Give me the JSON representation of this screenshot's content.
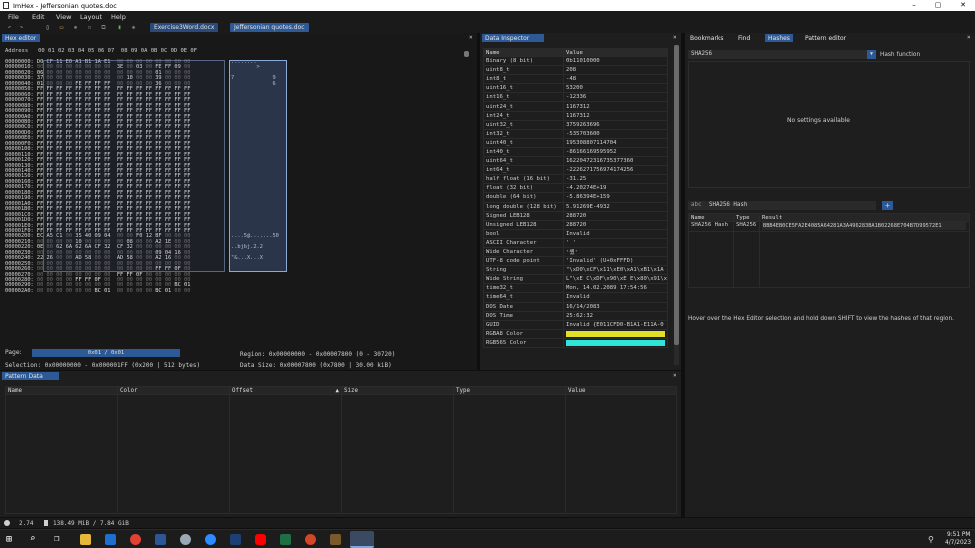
{
  "window": {
    "title": "ImHex - Jeffersonian quotes.doc",
    "min": "–",
    "max": "▢",
    "close": "✕"
  },
  "menu": [
    "File",
    "Edit",
    "View",
    "Layout",
    "Help"
  ],
  "file_tabs": [
    "Exercise3Word.docx",
    "Jeffersonian quotes.doc"
  ],
  "hex_editor": {
    "tab": "Hex editor",
    "close": "×",
    "header": "Address   00 01 02 03 04 05 06 07  08 09 0A 0B 0C 0D 0E 0F",
    "rows": [
      {
        "addr": "00000000:",
        "hex": "D0 CF 11 E0 A1 B1 1A E1  00 00 00 00 00 00 00 00",
        "ascii": "........"
      },
      {
        "addr": "00000010:",
        "hex": "00 00 00 00 00 00 00 00  3E 00 03 00 FE FF 09 00",
        "ascii": "        >"
      },
      {
        "addr": "00000020:",
        "hex": "06 00 00 00 00 00 00 00  00 00 00 00 01 00 00 00",
        "ascii": ""
      },
      {
        "addr": "00000030:",
        "hex": "37 00 00 00 00 00 00 00  00 10 00 00 39 00 00 00",
        "ascii": "7            9"
      },
      {
        "addr": "00000040:",
        "hex": "01 00 00 00 FE FF FF FF  00 00 00 00 36 00 00 00",
        "ascii": "             6"
      },
      {
        "addr": "00000050:",
        "hex": "FF FF FF FF FF FF FF FF  FF FF FF FF FF FF FF FF",
        "ascii": ""
      },
      {
        "addr": "00000060:",
        "hex": "FF FF FF FF FF FF FF FF  FF FF FF FF FF FF FF FF",
        "ascii": ""
      },
      {
        "addr": "00000070:",
        "hex": "FF FF FF FF FF FF FF FF  FF FF FF FF FF FF FF FF",
        "ascii": ""
      },
      {
        "addr": "00000080:",
        "hex": "FF FF FF FF FF FF FF FF  FF FF FF FF FF FF FF FF",
        "ascii": ""
      },
      {
        "addr": "00000090:",
        "hex": "FF FF FF FF FF FF FF FF  FF FF FF FF FF FF FF FF",
        "ascii": ""
      },
      {
        "addr": "000000A0:",
        "hex": "FF FF FF FF FF FF FF FF  FF FF FF FF FF FF FF FF",
        "ascii": ""
      },
      {
        "addr": "000000B0:",
        "hex": "FF FF FF FF FF FF FF FF  FF FF FF FF FF FF FF FF",
        "ascii": ""
      },
      {
        "addr": "000000C0:",
        "hex": "FF FF FF FF FF FF FF FF  FF FF FF FF FF FF FF FF",
        "ascii": ""
      },
      {
        "addr": "000000D0:",
        "hex": "FF FF FF FF FF FF FF FF  FF FF FF FF FF FF FF FF",
        "ascii": ""
      },
      {
        "addr": "000000E0:",
        "hex": "FF FF FF FF FF FF FF FF  FF FF FF FF FF FF FF FF",
        "ascii": ""
      },
      {
        "addr": "000000F0:",
        "hex": "FF FF FF FF FF FF FF FF  FF FF FF FF FF FF FF FF",
        "ascii": ""
      },
      {
        "addr": "00000100:",
        "hex": "FF FF FF FF FF FF FF FF  FF FF FF FF FF FF FF FF",
        "ascii": ""
      },
      {
        "addr": "00000110:",
        "hex": "FF FF FF FF FF FF FF FF  FF FF FF FF FF FF FF FF",
        "ascii": ""
      },
      {
        "addr": "00000120:",
        "hex": "FF FF FF FF FF FF FF FF  FF FF FF FF FF FF FF FF",
        "ascii": ""
      },
      {
        "addr": "00000130:",
        "hex": "FF FF FF FF FF FF FF FF  FF FF FF FF FF FF FF FF",
        "ascii": ""
      },
      {
        "addr": "00000140:",
        "hex": "FF FF FF FF FF FF FF FF  FF FF FF FF FF FF FF FF",
        "ascii": ""
      },
      {
        "addr": "00000150:",
        "hex": "FF FF FF FF FF FF FF FF  FF FF FF FF FF FF FF FF",
        "ascii": ""
      },
      {
        "addr": "00000160:",
        "hex": "FF FF FF FF FF FF FF FF  FF FF FF FF FF FF FF FF",
        "ascii": ""
      },
      {
        "addr": "00000170:",
        "hex": "FF FF FF FF FF FF FF FF  FF FF FF FF FF FF FF FF",
        "ascii": ""
      },
      {
        "addr": "00000180:",
        "hex": "FF FF FF FF FF FF FF FF  FF FF FF FF FF FF FF FF",
        "ascii": ""
      },
      {
        "addr": "00000190:",
        "hex": "FF FF FF FF FF FF FF FF  FF FF FF FF FF FF FF FF",
        "ascii": ""
      },
      {
        "addr": "000001A0:",
        "hex": "FF FF FF FF FF FF FF FF  FF FF FF FF FF FF FF FF",
        "ascii": ""
      },
      {
        "addr": "000001B0:",
        "hex": "FF FF FF FF FF FF FF FF  FF FF FF FF FF FF FF FF",
        "ascii": ""
      },
      {
        "addr": "000001C0:",
        "hex": "FF FF FF FF FF FF FF FF  FF FF FF FF FF FF FF FF",
        "ascii": ""
      },
      {
        "addr": "000001D0:",
        "hex": "FF FF FF FF FF FF FF FF  FF FF FF FF FF FF FF FF",
        "ascii": ""
      },
      {
        "addr": "000001E0:",
        "hex": "FF FF FF FF FF FF FF FF  FF FF FF FF FF FF FF FF",
        "ascii": ""
      },
      {
        "addr": "000001F0:",
        "hex": "FF FF FF FF FF FF FF FF  FF FF FF FF FF FF FF FF",
        "ascii": ""
      },
      {
        "addr": "00000200:",
        "hex": "EC A5 C1 00 35 40 09 04  00 00 F0 12 BF 00 00 00",
        "ascii": "....5@.......50"
      },
      {
        "addr": "00000210:",
        "hex": "00 00 00 00 10 00 00 00  00 08 00 00 A2 1E 00 00",
        "ascii": ""
      },
      {
        "addr": "00000220:",
        "hex": "0E 00 62 6A 62 6A CF 32  CF 32 00 00 00 00 00 00",
        "ascii": "..bjbj.2.2"
      },
      {
        "addr": "00000230:",
        "hex": "00 00 00 00 00 00 00 00  00 00 00 00 09 04 16 00",
        "ascii": ""
      },
      {
        "addr": "00000240:",
        "hex": "22 26 00 00 AD 58 00 00  AD 58 00 00 A2 16 00 00",
        "ascii": "\"&...X...X"
      },
      {
        "addr": "00000250:",
        "hex": "00 00 00 00 00 00 00 00  00 00 00 00 00 00 00 00",
        "ascii": ""
      },
      {
        "addr": "00000260:",
        "hex": "00 00 00 00 00 00 00 00  00 00 00 00 FF FF 0F 00",
        "ascii": ""
      },
      {
        "addr": "00000270:",
        "hex": "00 00 00 00 00 00 00 00  FF FF 0F 00 00 00 00 00",
        "ascii": ""
      },
      {
        "addr": "00000280:",
        "hex": "00 00 00 00 FF FF 0F 00  00 00 00 00 00 00 00 00",
        "ascii": ""
      },
      {
        "addr": "00000290:",
        "hex": "00 00 00 00 00 00 00 00  00 00 00 00 00 00 BC 01",
        "ascii": ""
      },
      {
        "addr": "000002A0:",
        "hex": "00 00 00 00 00 00 BC 01  00 00 00 00 BC 01 00 00",
        "ascii": ""
      }
    ],
    "page_label": "Page:",
    "page_value": "0x01 / 0x01",
    "region": "Region: 0x00000000 - 0x00007800 (0 - 30720)",
    "selection": "Selection: 0x00000000 - 0x000001FF (0x200 | 512 bytes)",
    "data_size": "Data Size: 0x00007800 (0x7800 | 30.00 kiB)"
  },
  "data_inspector": {
    "tab": "Data Inspector",
    "close": "×",
    "col_name": "Name",
    "col_value": "Value",
    "rows": [
      {
        "name": "Binary (8 bit)",
        "value": "0b11010000"
      },
      {
        "name": "uint8_t",
        "value": "208"
      },
      {
        "name": "int8_t",
        "value": "-48"
      },
      {
        "name": "uint16_t",
        "value": "53200"
      },
      {
        "name": "int16_t",
        "value": "-12336"
      },
      {
        "name": "uint24_t",
        "value": "1167312"
      },
      {
        "name": "int24_t",
        "value": "1167312"
      },
      {
        "name": "uint32_t",
        "value": "3759263696"
      },
      {
        "name": "int32_t",
        "value": "-535703600"
      },
      {
        "name": "uint40_t",
        "value": "195308807114704"
      },
      {
        "name": "int40_t",
        "value": "-86166169595952"
      },
      {
        "name": "uint64_t",
        "value": "16220472316735377360"
      },
      {
        "name": "int64_t",
        "value": "-2226271756974174256"
      },
      {
        "name": "half float (16 bit)",
        "value": "-31.25"
      },
      {
        "name": "float (32 bit)",
        "value": "-4.20274E+19"
      },
      {
        "name": "double (64 bit)",
        "value": "-5.86394E+159"
      },
      {
        "name": "long double (128 bit)",
        "value": "5.91269E-4932"
      },
      {
        "name": "Signed LEB128",
        "value": "288720"
      },
      {
        "name": "Unsigned LEB128",
        "value": "288720"
      },
      {
        "name": "bool",
        "value": "Invalid"
      },
      {
        "name": "ASCII Character",
        "value": "' '"
      },
      {
        "name": "Wide Character",
        "value": "'쏐'"
      },
      {
        "name": "UTF-8 code point",
        "value": "'Invalid' (U+0xFFFD)"
      },
      {
        "name": "String",
        "value": "\"\\xD0\\xCF\\x11\\xE0\\xA1\\xB1\\x1A"
      },
      {
        "name": "Wide String",
        "value": "L\"\\xE C\\xDF\\x90\\xE E\\x80\\x91\\xE"
      },
      {
        "name": "time32_t",
        "value": "Mon, 14.02.2089 17:54:56"
      },
      {
        "name": "time64_t",
        "value": "Invalid"
      },
      {
        "name": "DOS Date",
        "value": "16/14/2083"
      },
      {
        "name": "DOS Time",
        "value": "25:62:32"
      },
      {
        "name": "GUID",
        "value": "Invalid {E011CFD0-B1A1-E11A-0"
      },
      {
        "name": "RGBA8 Color",
        "value": ""
      },
      {
        "name": "RGB565 Color",
        "value": ""
      }
    ],
    "rgba_color": "#e2df28",
    "rgb565_color": "#2ee6d8"
  },
  "right_panel": {
    "tabs": [
      "Bookmarks",
      "Find",
      "Hashes",
      "Pattern editor"
    ],
    "active_tab": "Hashes",
    "close": "×",
    "hash_function_value": "SHA256",
    "hash_function_label": "Hash function",
    "no_settings": "No settings available",
    "name_input": "SHA256 Hash",
    "name_prefix": "abc",
    "add_button": "+",
    "table_headers": [
      "Name",
      "Type",
      "Result"
    ],
    "table_rows": [
      {
        "name": "SHA256 Hash",
        "type": "SHA256",
        "result": "BBB4EB0CE5FA2E4085A64281A3A496283BA1B02268E704B7D99572E1"
      }
    ],
    "hint": "Hover over the Hex Editor selection and hold down SHIFT to view the hashes of that region."
  },
  "pattern_data": {
    "tab": "Pattern Data",
    "close": "×",
    "columns": [
      "Name",
      "Color",
      "Offset",
      "Size",
      "Type",
      "Value"
    ]
  },
  "status_bar": {
    "fps": "2.74",
    "memory": "138.49 MiB / 7.84 GiB"
  },
  "taskbar": {
    "time": "9:51 PM",
    "date": "4/7/2023"
  }
}
